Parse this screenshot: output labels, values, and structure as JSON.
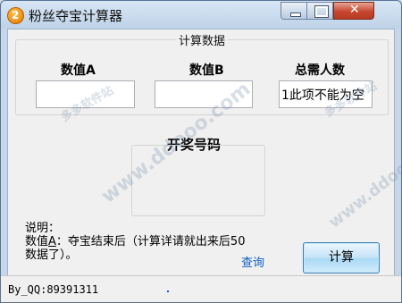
{
  "window": {
    "title": "粉丝夺宝计算器",
    "icon": "app-logo-icon",
    "controls": {
      "minimize": "minimize-icon",
      "maximize": "maximize-icon",
      "close": "close-icon",
      "close_glyph": "✕"
    }
  },
  "group": {
    "title": "计算数据",
    "fields": [
      {
        "label": "数值A",
        "value": ""
      },
      {
        "label": "数值B",
        "value": ""
      },
      {
        "label": "总需人数",
        "value": "1此项不能为空"
      }
    ]
  },
  "draw": {
    "title": "开奖号码",
    "value": ""
  },
  "description": {
    "line1": "说明：",
    "line2_prefix": "数值",
    "line2_key": "A",
    "line2_rest": "：夺宝结束后（计算详请就出来后50",
    "line3": "数据了）。"
  },
  "query_link": "查询",
  "calc_button": "计算",
  "status_bar": {
    "text": "By_QQ:89391311"
  },
  "watermarks": [
    "多多软件站",
    "www.ddooo.com",
    "多多软件站",
    "www.ddooo.com"
  ],
  "colors": {
    "title_bar": "#c6d7ea",
    "close_button": "#c6472f",
    "link": "#0b5ebd",
    "button_border": "#3c7fb1"
  }
}
